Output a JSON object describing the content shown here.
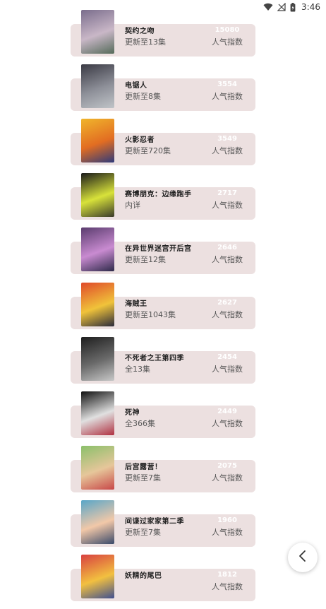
{
  "status_bar": {
    "time": "3:46",
    "icons": [
      "wifi-icon",
      "signal-off-icon",
      "battery-icon"
    ]
  },
  "list": {
    "popularity_label": "人气指数",
    "items": [
      {
        "title": "契约之吻",
        "update": "更新至13集",
        "popularity": "15080",
        "colors": [
          "#7a6d8c",
          "#c9b7c7",
          "#556b5a"
        ]
      },
      {
        "title": "电锯人",
        "update": "更新至8集",
        "popularity": "3554",
        "colors": [
          "#3a3a44",
          "#8d8f98",
          "#c0c4c8"
        ]
      },
      {
        "title": "火影忍者",
        "update": "更新至720集",
        "popularity": "3549",
        "colors": [
          "#f0b52c",
          "#e26d22",
          "#2f3a7a"
        ]
      },
      {
        "title": "赛博朋克：边缘跑手",
        "update": "内详",
        "popularity": "2717",
        "colors": [
          "#1a1a1a",
          "#d8e23a",
          "#3a3a2a"
        ]
      },
      {
        "title": "在异世界迷宫开后宫",
        "update": "更新至12集",
        "popularity": "2646",
        "colors": [
          "#5a3c6e",
          "#c98bd1",
          "#2e2a4a"
        ]
      },
      {
        "title": "海贼王",
        "update": "更新至1043集",
        "popularity": "2627",
        "colors": [
          "#e04a2a",
          "#f0c33a",
          "#2a2a3a"
        ]
      },
      {
        "title": "不死者之王第四季",
        "update": "全13集",
        "popularity": "2454",
        "colors": [
          "#1e1e1e",
          "#6a6a6a",
          "#c8c8c8"
        ]
      },
      {
        "title": "死神",
        "update": "全366集",
        "popularity": "2449",
        "colors": [
          "#101010",
          "#e0e0e0",
          "#b03040"
        ]
      },
      {
        "title": "后宫露营！",
        "update": "更新至7集",
        "popularity": "2075",
        "colors": [
          "#8bc06a",
          "#e6c69a",
          "#c84848"
        ]
      },
      {
        "title": "间谍过家家第二季",
        "update": "更新至7集",
        "popularity": "1960",
        "colors": [
          "#58a6c8",
          "#f2c8a8",
          "#3a4a6a"
        ]
      },
      {
        "title": "妖精的尾巴",
        "update": "",
        "popularity": "1812",
        "colors": [
          "#d84040",
          "#f2c040",
          "#405090"
        ]
      }
    ]
  }
}
